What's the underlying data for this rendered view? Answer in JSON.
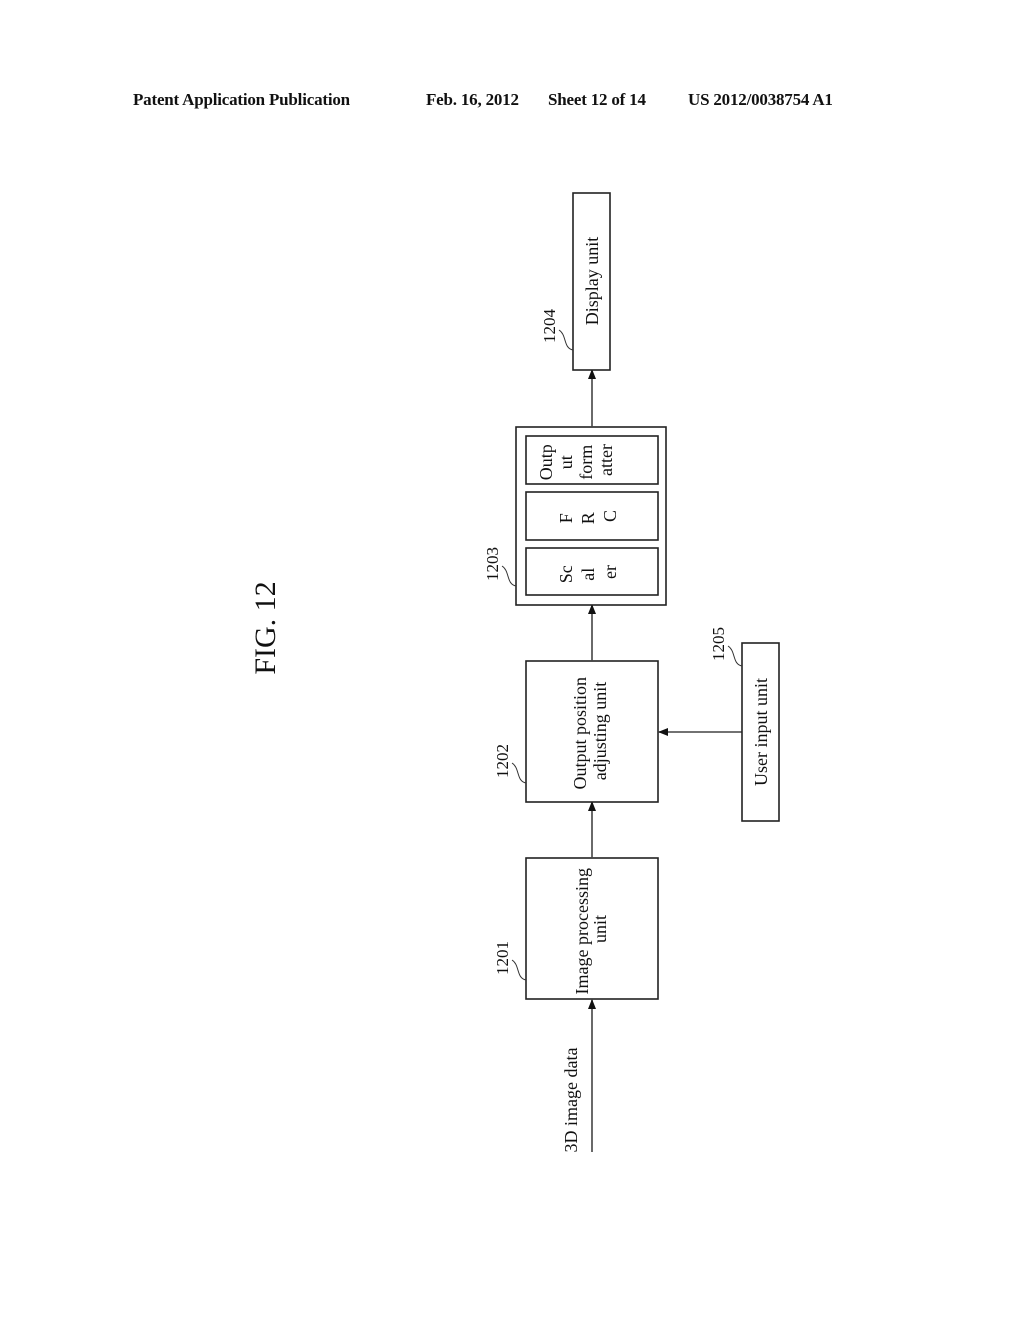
{
  "header": {
    "publication": "Patent Application Publication",
    "date": "Feb. 16, 2012",
    "sheet": "Sheet 12 of 14",
    "number": "US 2012/0038754 A1"
  },
  "figure": {
    "title": "FIG. 12",
    "input_label": "3D image data",
    "blocks": [
      {
        "ref": "1201",
        "lines": [
          "Image processing",
          "unit"
        ]
      },
      {
        "ref": "1202",
        "lines": [
          "Output position",
          "adjusting unit"
        ]
      },
      {
        "ref": "1203",
        "sub_blocks": [
          {
            "lines": [
              "Sc",
              "al",
              "er"
            ]
          },
          {
            "lines": [
              "F",
              "R",
              "C"
            ]
          },
          {
            "lines": [
              "Outp",
              "ut",
              "form",
              "atter"
            ]
          }
        ]
      },
      {
        "ref": "1204",
        "lines": [
          "Display unit"
        ]
      },
      {
        "ref": "1205",
        "lines": [
          "User input unit"
        ]
      }
    ]
  }
}
